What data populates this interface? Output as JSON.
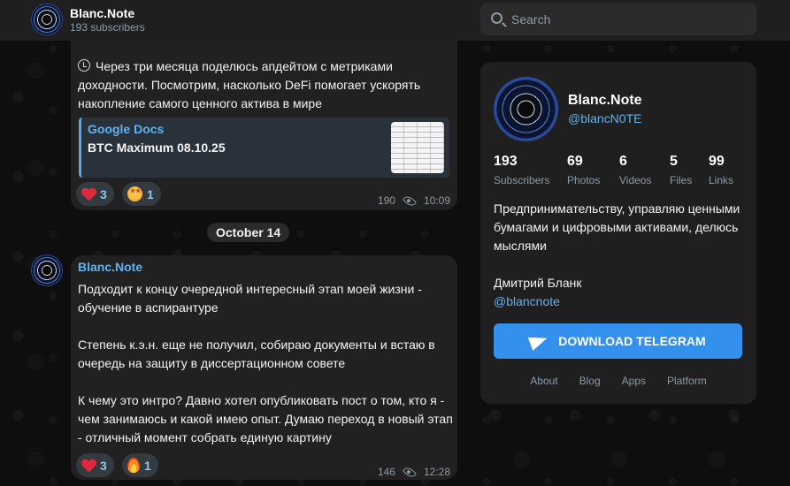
{
  "header": {
    "title": "Blanc.Note",
    "subtitle": "193 subscribers",
    "search_placeholder": "Search"
  },
  "messages": [
    {
      "text": "Через три месяца поделюсь апдейтом с метриками доходности. Посмотрим, насколько DeFi помогает ускорять накопление самого ценного актива в мире",
      "link_preview": {
        "source": "Google Docs",
        "title": "BTC Maximum 08.10.25"
      },
      "reactions": [
        {
          "emoji": "heart",
          "count": "3"
        },
        {
          "emoji": "star-struck",
          "count": "1"
        }
      ],
      "views": "190",
      "time": "10:09"
    },
    {
      "author": "Blanc.Note",
      "text": "Подходит к концу очередной интересный этап моей жизни - обучение в аспирантуре\n\nСтепень к.э.н. еще не получил, собираю документы и встаю в очередь на защиту в диссертационном совете\n\nК чему это интро? Давно хотел опубликовать пост о том, кто я - чем занимаюсь и какой имею опыт. Думаю переход в новый этап - отличный момент собрать единую картину",
      "reactions": [
        {
          "emoji": "heart",
          "count": "3"
        },
        {
          "emoji": "fire",
          "count": "1"
        }
      ],
      "views": "146",
      "time": "12:28"
    }
  ],
  "date_separator": "October 14",
  "channel_card": {
    "name": "Blanc.Note",
    "handle": "@blancN0TE",
    "stats": [
      {
        "value": "193",
        "label": "Subscribers"
      },
      {
        "value": "69",
        "label": "Photos"
      },
      {
        "value": "6",
        "label": "Videos"
      },
      {
        "value": "5",
        "label": "Files"
      },
      {
        "value": "99",
        "label": "Links"
      }
    ],
    "description": "Предпринимательству, управляю ценными бумагами и цифровыми активами, делюсь мыслями",
    "person": "Дмитрий Бланк",
    "person_handle": "@blancnote",
    "download_button": "DOWNLOAD TELEGRAM",
    "footer_links": [
      "About",
      "Blog",
      "Apps",
      "Platform"
    ]
  },
  "colors": {
    "accent": "#3390ec",
    "link": "#62b2ee",
    "bubble": "#212121",
    "panel": "#1f1f1f"
  }
}
